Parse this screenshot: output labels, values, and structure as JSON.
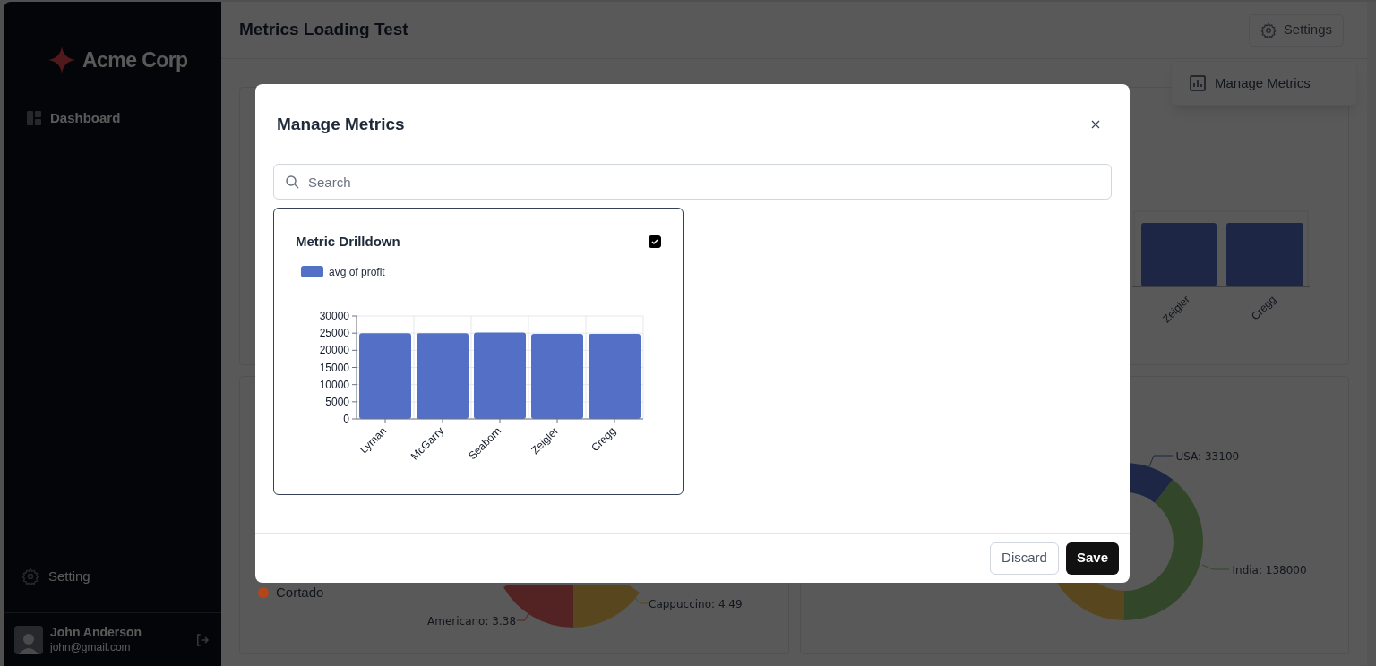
{
  "sidebar": {
    "brand": "Acme Corp",
    "items": [
      {
        "label": "Dashboard"
      }
    ],
    "footer_items": [
      {
        "label": "Setting"
      }
    ],
    "user": {
      "name": "John Anderson",
      "email": "john@gmail.com"
    }
  },
  "header": {
    "title": "Metrics Loading Test",
    "settings_button": "Settings"
  },
  "settings_menu": {
    "items": [
      "Manage Metrics"
    ]
  },
  "background": {
    "bar_chart_labels": [
      "Zeigler",
      "Cregg"
    ],
    "pie_legend": [
      {
        "label": "Cortado",
        "color": "#b5451b"
      }
    ],
    "pie_labels": [
      "Americano: 3.38",
      "Cappuccino: 4.49"
    ],
    "donut_labels": [
      "USA: 33100",
      "India: 138000"
    ]
  },
  "modal": {
    "title": "Manage Metrics",
    "search": {
      "placeholder": "Search"
    },
    "metrics": [
      {
        "title": "Metric Drilldown",
        "checked": true,
        "chart_data": {
          "type": "bar",
          "categories": [
            "Lyman",
            "McGarry",
            "Seaborn",
            "Zeigler",
            "Cregg"
          ],
          "series": [
            {
              "name": "avg of profit",
              "color": "#5470c6",
              "values": [
                25000,
                25000,
                25200,
                24800,
                24800
              ]
            }
          ],
          "ylim": [
            0,
            30000
          ],
          "grid": true,
          "yticks": [
            0,
            5000,
            10000,
            15000,
            20000,
            25000,
            30000
          ]
        }
      }
    ],
    "buttons": [
      {
        "label": "Discard",
        "kind": "secondary"
      },
      {
        "label": "Save",
        "kind": "primary"
      }
    ]
  }
}
